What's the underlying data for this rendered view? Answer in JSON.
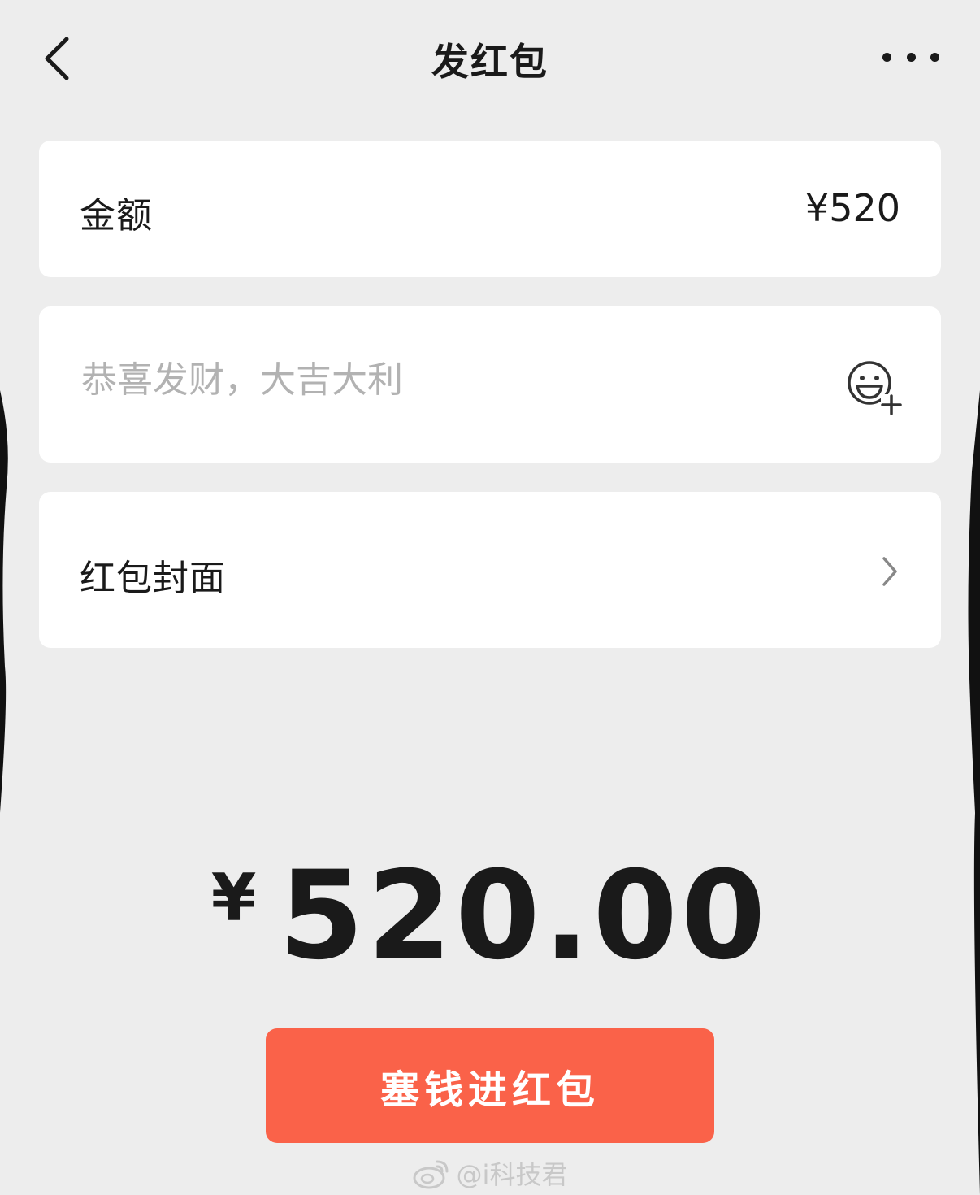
{
  "header": {
    "title": "发红包",
    "back_icon": "chevron-left-icon",
    "more_icon": "more-horizontal-icon"
  },
  "amount_row": {
    "label": "金额",
    "value": "¥520"
  },
  "greeting_row": {
    "placeholder": "恭喜发财，大吉大利",
    "value": "",
    "emoji_icon": "emoji-add-icon"
  },
  "cover_row": {
    "label": "红包封面",
    "chevron_icon": "chevron-right-icon"
  },
  "total": {
    "currency": "¥",
    "amount": "520.00"
  },
  "submit": {
    "label": "塞钱进红包"
  },
  "watermark": {
    "text": "@i科技君",
    "icon": "weibo-icon"
  },
  "colors": {
    "background": "#ededed",
    "card": "#ffffff",
    "accent": "#fa6249",
    "text": "#1a1a1a",
    "placeholder": "#b2b2b2"
  }
}
